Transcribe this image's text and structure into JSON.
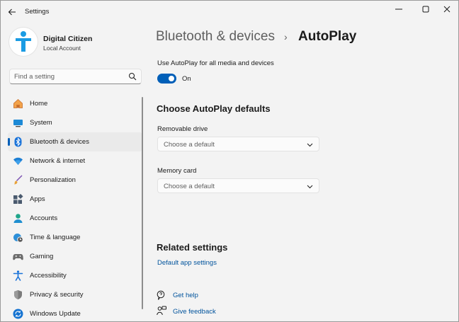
{
  "window": {
    "title": "Settings"
  },
  "profile": {
    "name": "Digital Citizen",
    "account_type": "Local Account"
  },
  "search": {
    "placeholder": "Find a setting"
  },
  "sidebar": {
    "items": [
      {
        "label": "Home",
        "icon": "home-icon"
      },
      {
        "label": "System",
        "icon": "system-icon"
      },
      {
        "label": "Bluetooth & devices",
        "icon": "bluetooth-icon",
        "active": true
      },
      {
        "label": "Network & internet",
        "icon": "wifi-icon"
      },
      {
        "label": "Personalization",
        "icon": "brush-icon"
      },
      {
        "label": "Apps",
        "icon": "apps-icon"
      },
      {
        "label": "Accounts",
        "icon": "accounts-icon"
      },
      {
        "label": "Time & language",
        "icon": "globe-clock-icon"
      },
      {
        "label": "Gaming",
        "icon": "gamepad-icon"
      },
      {
        "label": "Accessibility",
        "icon": "accessibility-icon"
      },
      {
        "label": "Privacy & security",
        "icon": "shield-icon"
      },
      {
        "label": "Windows Update",
        "icon": "update-icon"
      }
    ]
  },
  "breadcrumb": {
    "parent": "Bluetooth & devices",
    "separator": "›",
    "current": "AutoPlay"
  },
  "autoplay": {
    "toggle_label": "Use AutoPlay for all media and devices",
    "toggle_state": "On",
    "toggle_on": true
  },
  "defaults": {
    "heading": "Choose AutoPlay defaults",
    "removable_label": "Removable drive",
    "removable_value": "Choose a default",
    "memory_label": "Memory card",
    "memory_value": "Choose a default"
  },
  "related": {
    "heading": "Related settings",
    "default_apps_link": "Default app settings"
  },
  "help": {
    "get_help": "Get help",
    "give_feedback": "Give feedback"
  },
  "colors": {
    "accent": "#005fb8",
    "background": "#f3f3f3",
    "link": "#00539c"
  }
}
